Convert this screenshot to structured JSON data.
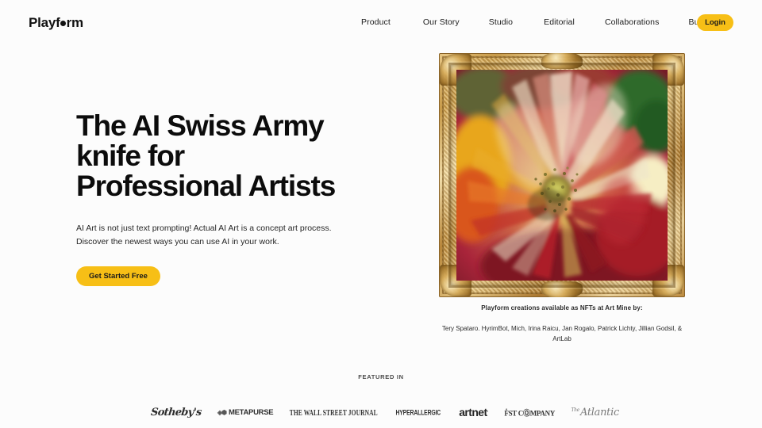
{
  "brand": {
    "name_part1": "Playf",
    "name_dot": "o",
    "name_part2": "rm",
    "full_name": "Playform"
  },
  "header": {
    "nav_items": [
      {
        "label": "Product"
      },
      {
        "label": "Our Story"
      },
      {
        "label": "Studio"
      },
      {
        "label": "Editorial"
      },
      {
        "label": "Collaborations"
      },
      {
        "label": "Buy Art"
      }
    ],
    "login_label": "Login",
    "accent_color": "#f7bf16"
  },
  "hero": {
    "headline_line1": "The AI Swiss Army",
    "headline_line2": "knife for",
    "headline_line3": "Professional Artists",
    "subtitle_line1": "AI Art is not just text prompting! Actual AI Art is a concept art process.",
    "subtitle_line2": "Discover the newest ways you can use AI in your work.",
    "cta_label": "Get Started Free"
  },
  "artwork": {
    "alt": "abstract-ai-flower-painting-in-gold-baroque-frame",
    "caption_line1": "Playform creations available as NFTs at Art Mine by:",
    "caption_line2": "Tery Spataro. HyrimBot, Mich, Irina Raicu, Jan Rogalo, Patrick Lichty, Jillian Godsil, & ArtLab"
  },
  "featured": {
    "label": "FEATURED IN",
    "logos": [
      {
        "name": "sothebys",
        "text": "Sotheby's"
      },
      {
        "name": "metapurse",
        "mark": "◈⬢",
        "text": "METAPURSE"
      },
      {
        "name": "wall-street-journal",
        "text": "THE WALL STREET JOURNAL"
      },
      {
        "name": "hyperallergic",
        "text": "HYPERALLERGIC"
      },
      {
        "name": "artnet",
        "text": "artnet",
        "sup": "·"
      },
      {
        "name": "fast-company",
        "text": "F̊ST CⓄMPANY"
      },
      {
        "name": "the-atlantic",
        "the": "The",
        "text": "Atlantic"
      }
    ]
  }
}
